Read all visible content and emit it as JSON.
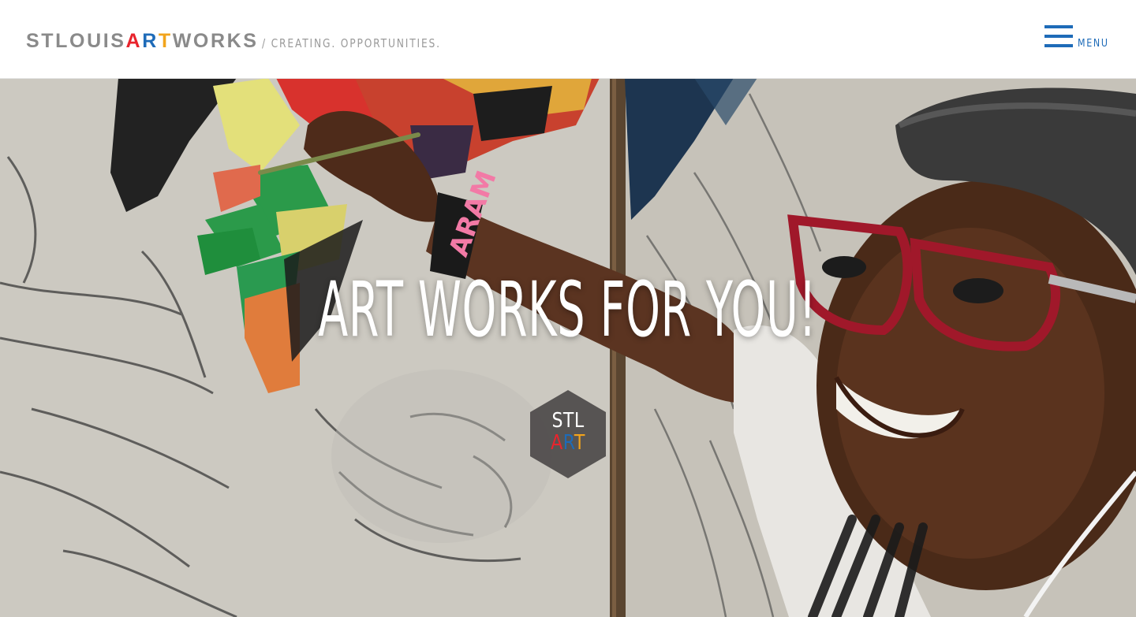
{
  "header": {
    "logo": {
      "parts": [
        {
          "text": "STLOUIS",
          "color": "#8a8a8a"
        },
        {
          "text": "A",
          "color": "#e8242d"
        },
        {
          "text": "R",
          "color": "#1e6bb8"
        },
        {
          "text": "T",
          "color": "#f2a41c"
        },
        {
          "text": "WORKS",
          "color": "#8a8a8a"
        }
      ],
      "tagline": "/ CREATING. OPPORTUNITIES."
    },
    "menu_label": "MENU",
    "menu_icon": "hamburger-icon"
  },
  "hero": {
    "title": "ART WORKS FOR YOU!",
    "badge": {
      "line1": "STL",
      "line2_parts": [
        {
          "text": "A",
          "color": "#e8242d"
        },
        {
          "text": "R",
          "color": "#1e6bb8"
        },
        {
          "text": "T",
          "color": "#f2a41c"
        }
      ]
    },
    "wristband_text": "ARAM"
  },
  "colors": {
    "accent_blue": "#1e6bb8",
    "brand_red": "#e8242d",
    "brand_yellow": "#f2a41c",
    "logo_gray": "#8a8a8a"
  }
}
